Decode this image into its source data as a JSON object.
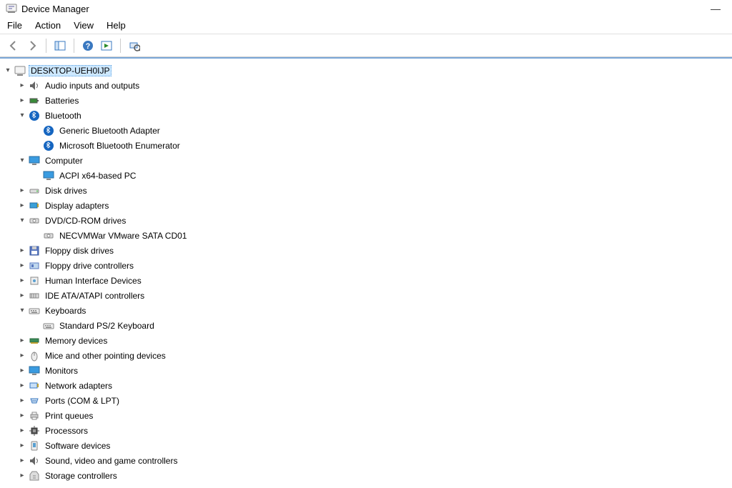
{
  "window": {
    "title": "Device Manager"
  },
  "menu": {
    "file": "File",
    "action": "Action",
    "view": "View",
    "help": "Help"
  },
  "tree": {
    "root": "DESKTOP-UEH0IJP",
    "audio": "Audio inputs and outputs",
    "batteries": "Batteries",
    "bluetooth": "Bluetooth",
    "bluetooth_adapter": "Generic Bluetooth Adapter",
    "bluetooth_enum": "Microsoft Bluetooth Enumerator",
    "computer": "Computer",
    "computer_child": "ACPI x64-based PC",
    "disk": "Disk drives",
    "display": "Display adapters",
    "dvd": "DVD/CD-ROM drives",
    "dvd_child": "NECVMWar VMware SATA CD01",
    "floppy_drives": "Floppy disk drives",
    "floppy_ctrl": "Floppy drive controllers",
    "hid": "Human Interface Devices",
    "ide": "IDE ATA/ATAPI controllers",
    "keyboards": "Keyboards",
    "keyboard_child": "Standard PS/2 Keyboard",
    "memory": "Memory devices",
    "mice": "Mice and other pointing devices",
    "monitors": "Monitors",
    "network": "Network adapters",
    "ports": "Ports (COM & LPT)",
    "printq": "Print queues",
    "processors": "Processors",
    "software": "Software devices",
    "sound": "Sound, video and game controllers",
    "storage": "Storage controllers"
  }
}
